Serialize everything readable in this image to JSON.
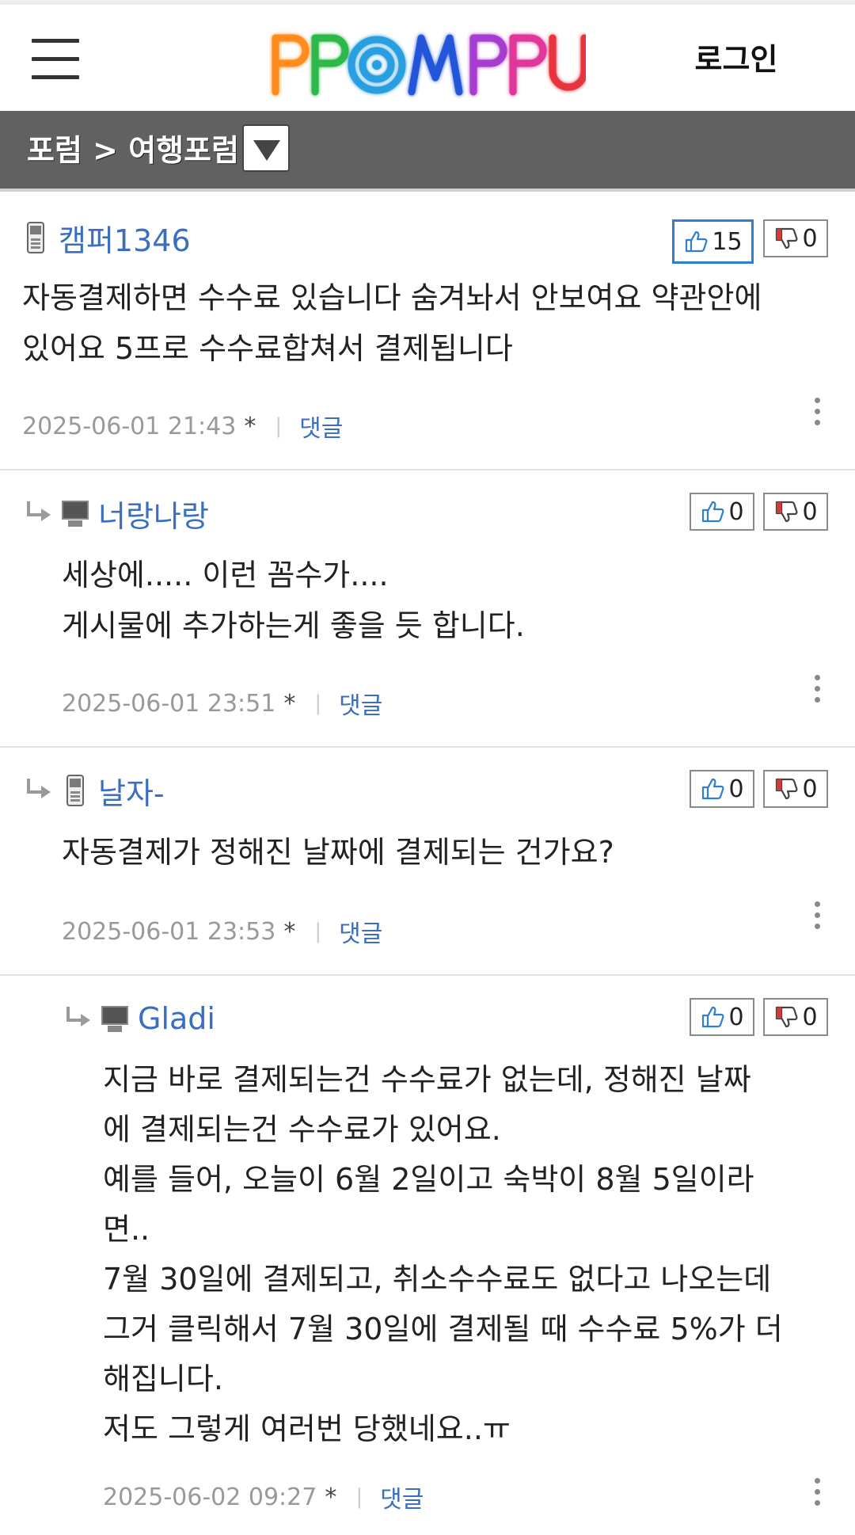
{
  "header": {
    "logo_text": "PPOMPPU",
    "login_label": "로그인"
  },
  "subbar": {
    "breadcrumb": "포럼 > 여행포럼"
  },
  "comments": [
    {
      "nickname": "캠퍼1346",
      "device": "mobile",
      "is_reply": false,
      "text": "자동결제하면 수수료 있습니다 숨겨놔서 안보여요 약관안에\n있어요 5프로 수수료합쳐서 결제됩니다",
      "timestamp": "2025-06-01 21:43",
      "star": "*",
      "reply_label": "댓글",
      "upvotes": "15",
      "downvotes": "0",
      "upvote_active": true
    },
    {
      "nickname": "너랑나랑",
      "device": "pc",
      "is_reply": true,
      "text": "세상에..... 이런 꼼수가....\n게시물에 추가하는게 좋을 듯 합니다.",
      "timestamp": "2025-06-01 23:51",
      "star": "*",
      "reply_label": "댓글",
      "upvotes": "0",
      "downvotes": "0",
      "upvote_active": false
    },
    {
      "nickname": "날자-",
      "device": "mobile",
      "is_reply": true,
      "text": "자동결제가 정해진 날짜에 결제되는 건가요?",
      "timestamp": "2025-06-01 23:53",
      "star": "*",
      "reply_label": "댓글",
      "upvotes": "0",
      "downvotes": "0",
      "upvote_active": false
    },
    {
      "nickname": "Gladi",
      "device": "pc",
      "is_reply": true,
      "text": "지금 바로 결제되는건 수수료가 없는데, 정해진 날짜\n에 결제되는건 수수료가 있어요.\n예를 들어, 오늘이 6월 2일이고 숙박이 8월 5일이라\n면..\n7월 30일에 결제되고, 취소수수료도 없다고 나오는데\n그거 클릭해서 7월 30일에 결제될 때 수수료 5%가 더\n해집니다.\n저도 그렇게 여러번 당했네요..ㅠ",
      "timestamp": "2025-06-02 09:27",
      "star": "*",
      "reply_label": "댓글",
      "upvotes": "0",
      "downvotes": "0",
      "upvote_active": false
    }
  ],
  "colors": {
    "nickname": "#3a6ebf",
    "subbar_bg": "#616161",
    "upvote_active_border": "#2f7fcf"
  }
}
